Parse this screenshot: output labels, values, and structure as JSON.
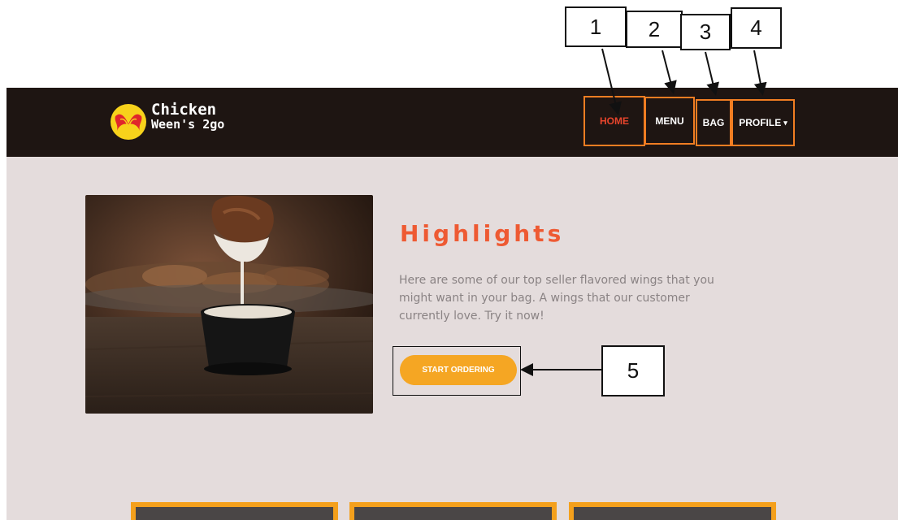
{
  "brand": {
    "line1": "Chicken",
    "line2": "Ween's 2go"
  },
  "nav": {
    "home": "HOME",
    "menu": "MENU",
    "bag": "BAG",
    "profile": "PROFILE",
    "caret": "▾"
  },
  "hero": {
    "title": "Highlights",
    "description": "Here are some of our top seller flavored wings that you might want in your bag. A wings that our customer currently love. Try it now!",
    "cta": "START ORDERING"
  },
  "callouts": [
    "1",
    "2",
    "3",
    "4",
    "5"
  ],
  "colors": {
    "accent": "#ee5a33",
    "button": "#f5a623",
    "navbar": "#1e1512",
    "background": "#e4dcdc"
  }
}
